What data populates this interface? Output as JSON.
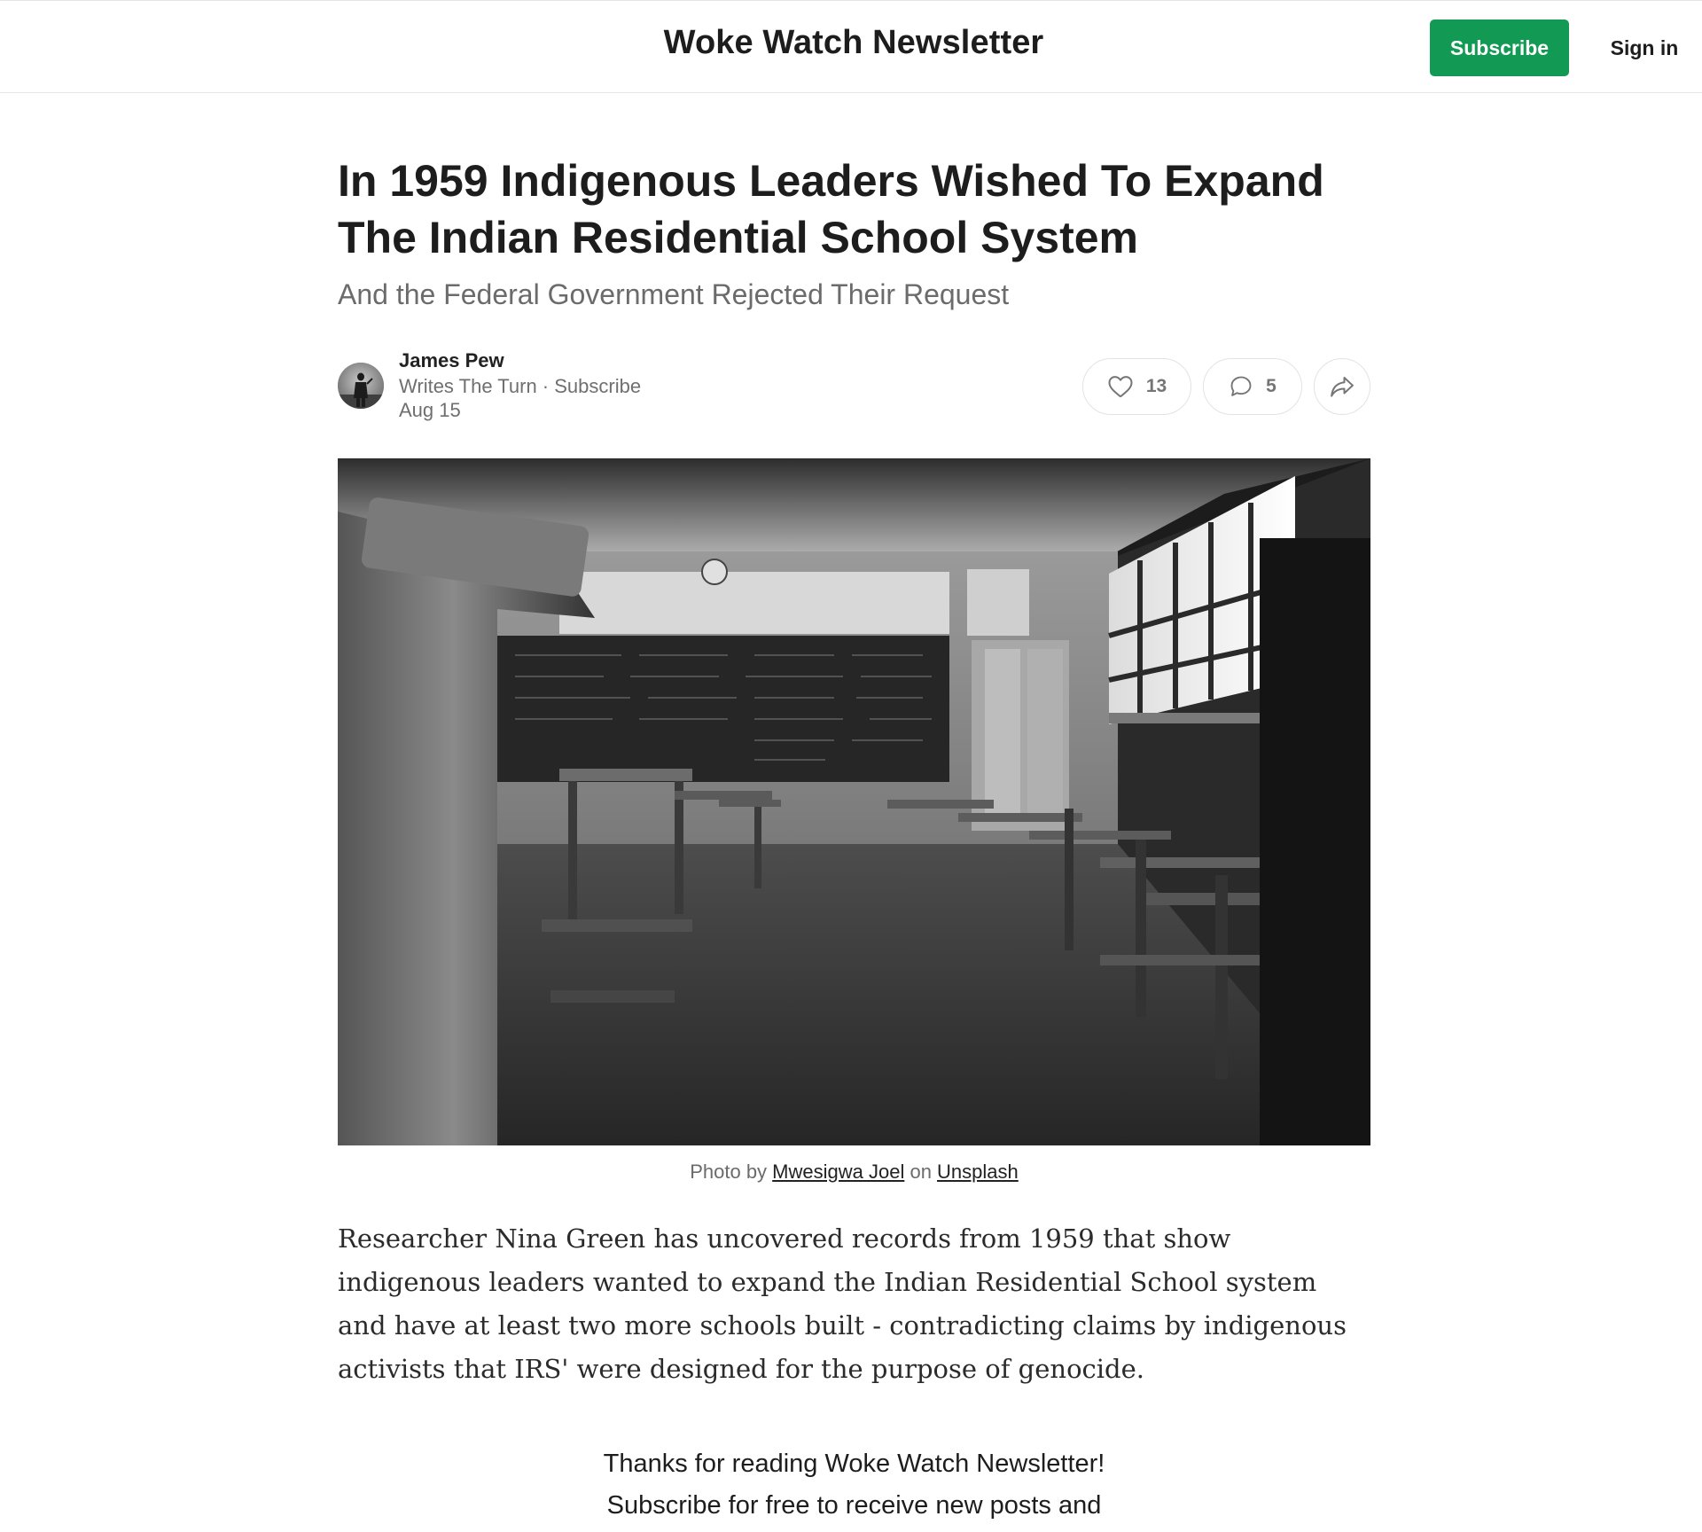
{
  "header": {
    "site_title": "Woke Watch Newsletter",
    "subscribe_label": "Subscribe",
    "signin_label": "Sign in",
    "accent_color": "#129a54"
  },
  "post": {
    "title": "In 1959 Indigenous Leaders Wished To Expand The Indian Residential School System",
    "subtitle": "And the Federal Government Rejected Their Request",
    "author": {
      "name": "James Pew",
      "writes_prefix": "Writes The Turn",
      "separator": " · ",
      "subscribe_link": "Subscribe"
    },
    "date": "Aug 15",
    "likes": "13",
    "comments": "5",
    "icons": [
      "heart-icon",
      "comment-icon",
      "share-icon"
    ]
  },
  "hero": {
    "caption_prefix": "Photo by ",
    "photographer": "Mwesigwa Joel",
    "caption_mid": " on ",
    "source": "Unsplash"
  },
  "body": {
    "paragraph_1": "Researcher Nina Green has uncovered records from 1959 that show indigenous leaders wanted to expand the Indian Residential School system and have at least two more schools built - contradicting claims by indigenous activists that IRS' were designed for the purpose of genocide."
  },
  "cta": {
    "line_1": "Thanks for reading Woke Watch Newsletter!",
    "line_2": "Subscribe for free to receive new posts and"
  }
}
